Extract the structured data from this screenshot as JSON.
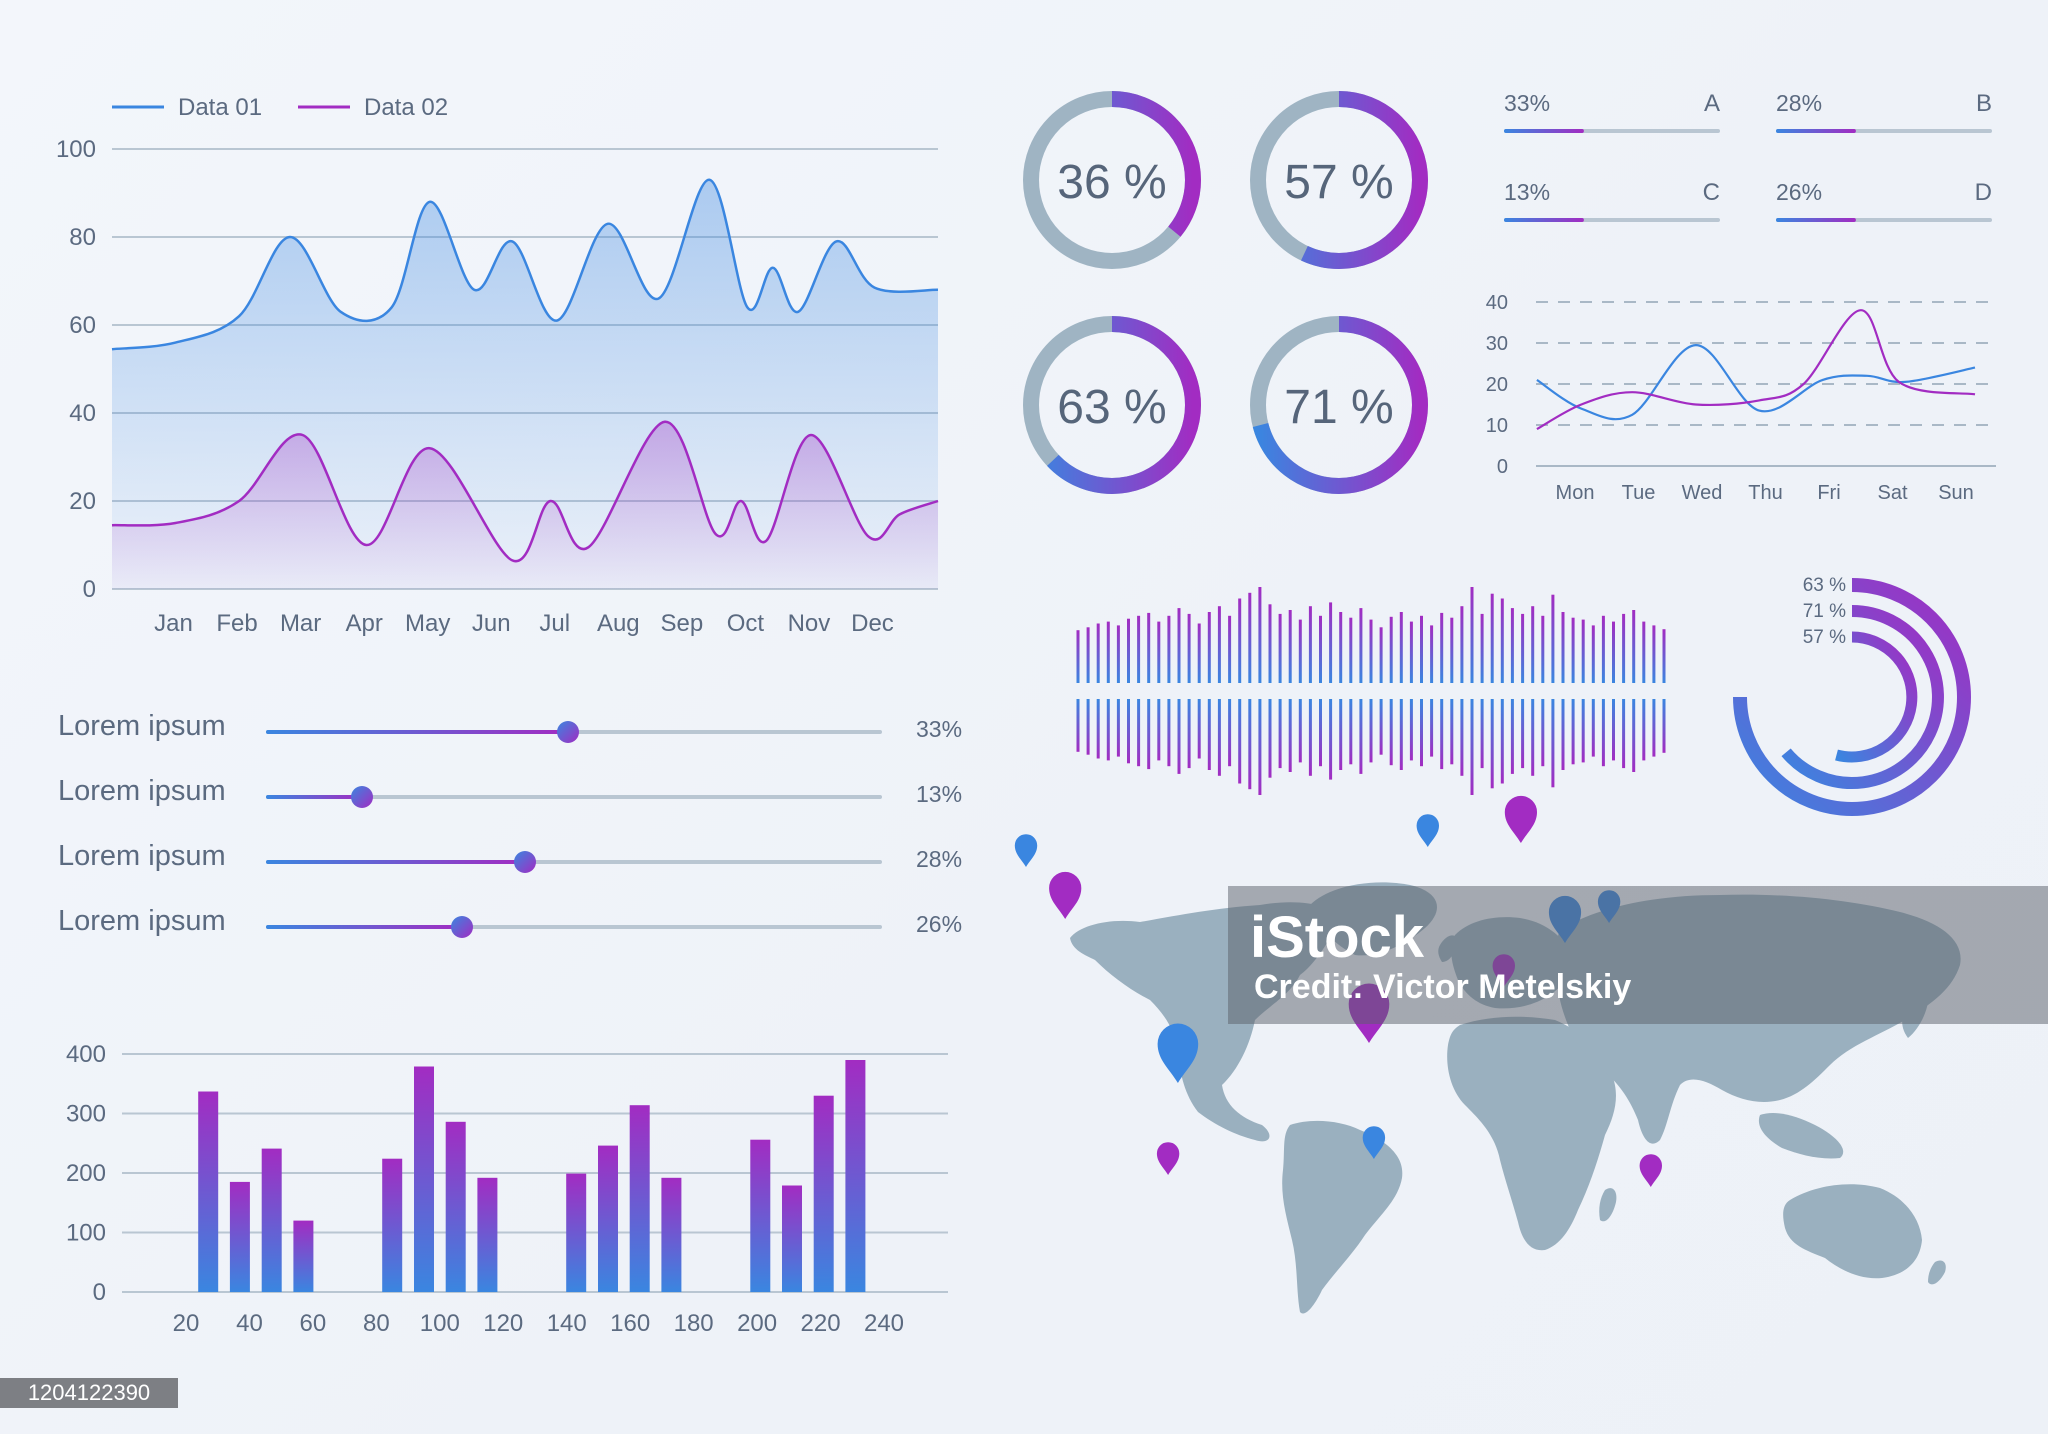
{
  "colors": {
    "blue": "#3a86e0",
    "purple": "#a22cc2",
    "gray_ring": "#9fb4c3",
    "grid": "#b9c6d2",
    "map": "#9ab0bf"
  },
  "chart_data": [
    {
      "type": "area",
      "legend": [
        "Data 01",
        "Data 02"
      ],
      "categories": [
        "Jan",
        "Feb",
        "Mar",
        "Apr",
        "May",
        "Jun",
        "Jul",
        "Aug",
        "Sep",
        "Oct",
        "Nov",
        "Dec"
      ],
      "yticks": [
        0,
        20,
        40,
        60,
        80,
        100
      ],
      "ylim": [
        0,
        100
      ],
      "x_range": [
        0,
        13
      ],
      "series": [
        {
          "name": "Data 01",
          "color": "#3a86e0",
          "points": [
            [
              0,
              54.5
            ],
            [
              1,
              56
            ],
            [
              2,
              62
            ],
            [
              2.8,
              80
            ],
            [
              3.6,
              63
            ],
            [
              4.4,
              64
            ],
            [
              5,
              88
            ],
            [
              5.7,
              68
            ],
            [
              6.3,
              79
            ],
            [
              7,
              61
            ],
            [
              7.8,
              83
            ],
            [
              8.6,
              66
            ],
            [
              9.4,
              93
            ],
            [
              10,
              64
            ],
            [
              10.4,
              73
            ],
            [
              10.8,
              63
            ],
            [
              11.4,
              79
            ],
            [
              12,
              68.5
            ],
            [
              13,
              68
            ]
          ]
        },
        {
          "name": "Data 02",
          "color": "#a22cc2",
          "points": [
            [
              0,
              14.5
            ],
            [
              1,
              15
            ],
            [
              2,
              20
            ],
            [
              3,
              35
            ],
            [
              4,
              10
            ],
            [
              5,
              32
            ],
            [
              6.3,
              6.5
            ],
            [
              6.9,
              20
            ],
            [
              7.5,
              9.5
            ],
            [
              8.7,
              38
            ],
            [
              9.5,
              12.5
            ],
            [
              9.9,
              20
            ],
            [
              10.3,
              11
            ],
            [
              11,
              35
            ],
            [
              11.9,
              12
            ],
            [
              12.4,
              17
            ],
            [
              13,
              20
            ]
          ]
        }
      ]
    },
    {
      "type": "bar",
      "xticks": [
        20,
        40,
        60,
        80,
        100,
        120,
        140,
        160,
        180,
        200,
        220,
        240
      ],
      "yticks": [
        0,
        100,
        200,
        300,
        400
      ],
      "xlim": [
        20,
        240
      ],
      "ylim": [
        0,
        400
      ],
      "groups": [
        {
          "x": [
            27,
            37,
            47,
            57
          ],
          "values": [
            337,
            185,
            241,
            120
          ]
        },
        {
          "x": [
            85,
            95,
            105,
            115
          ],
          "values": [
            224,
            379,
            286,
            192
          ]
        },
        {
          "x": [
            143,
            153,
            163,
            173
          ],
          "values": [
            199,
            246,
            314,
            192
          ]
        },
        {
          "x": [
            201,
            211,
            221,
            231
          ],
          "values": [
            256,
            179,
            330,
            390
          ]
        }
      ]
    },
    {
      "type": "line",
      "categories": [
        "Mon",
        "Tue",
        "Wed",
        "Thu",
        "Fri",
        "Sat",
        "Sun"
      ],
      "yticks": [
        0,
        10,
        20,
        30,
        40
      ],
      "ylim": [
        0,
        40
      ],
      "series": [
        {
          "color": "#3a86e0",
          "points": [
            [
              -0.6,
              21
            ],
            [
              0.1,
              14
            ],
            [
              0.9,
              12.5
            ],
            [
              1.9,
              29.5
            ],
            [
              2.9,
              13.5
            ],
            [
              3.9,
              21
            ],
            [
              4.6,
              22
            ],
            [
              5.2,
              20.5
            ],
            [
              6.3,
              24
            ]
          ]
        },
        {
          "color": "#a22cc2",
          "points": [
            [
              -0.6,
              9
            ],
            [
              0.1,
              15
            ],
            [
              0.9,
              18
            ],
            [
              1.9,
              15
            ],
            [
              2.9,
              16
            ],
            [
              3.6,
              20
            ],
            [
              4.5,
              38
            ],
            [
              5.1,
              20.5
            ],
            [
              6.3,
              17.5
            ]
          ]
        }
      ]
    },
    {
      "type": "donut",
      "values": [
        36,
        57,
        63,
        71
      ],
      "labels": [
        "36 %",
        "57 %",
        "63 %",
        "71 %"
      ]
    },
    {
      "type": "progress",
      "items": [
        {
          "name": "A",
          "value": 33,
          "label": "33%"
        },
        {
          "name": "B",
          "value": 28,
          "label": "28%"
        },
        {
          "name": "C",
          "value": 13,
          "label": "13%"
        },
        {
          "name": "D",
          "value": 26,
          "label": "26%"
        }
      ]
    },
    {
      "type": "radial",
      "rings": [
        {
          "label": "63 %",
          "value": 63
        },
        {
          "label": "71 %",
          "value": 71
        },
        {
          "label": "57 %",
          "value": 57
        }
      ]
    },
    {
      "type": "waveform",
      "values": [
        0.55,
        0.58,
        0.62,
        0.64,
        0.6,
        0.67,
        0.7,
        0.73,
        0.64,
        0.7,
        0.78,
        0.72,
        0.62,
        0.74,
        0.8,
        0.7,
        0.88,
        0.94,
        1.0,
        0.82,
        0.72,
        0.76,
        0.66,
        0.8,
        0.7,
        0.84,
        0.74,
        0.68,
        0.78,
        0.66,
        0.58,
        0.69,
        0.74,
        0.64,
        0.7,
        0.6,
        0.73,
        0.68,
        0.8,
        1.0,
        0.72,
        0.93,
        0.88,
        0.78,
        0.72,
        0.8,
        0.7,
        0.92,
        0.74,
        0.68,
        0.66,
        0.6,
        0.7,
        0.64,
        0.72,
        0.76,
        0.64,
        0.6,
        0.56
      ]
    }
  ],
  "sliders": [
    {
      "label": "Lorem ipsum",
      "value": 0.49,
      "pct": "33%"
    },
    {
      "label": "Lorem ipsum",
      "value": 0.156,
      "pct": "13%"
    },
    {
      "label": "Lorem ipsum",
      "value": 0.42,
      "pct": "28%"
    },
    {
      "label": "Lorem ipsum",
      "value": 0.318,
      "pct": "26%"
    }
  ],
  "map": {
    "pins": [
      {
        "lon": -120,
        "lat": 52,
        "color": "blue",
        "size": "s"
      },
      {
        "lon": -104,
        "lat": 39,
        "color": "purple",
        "size": "m"
      },
      {
        "lon": -58,
        "lat": -2,
        "color": "blue",
        "size": "l"
      },
      {
        "lon": -62,
        "lat": -25,
        "color": "purple",
        "size": "s"
      },
      {
        "lon": 20,
        "lat": 8,
        "color": "purple",
        "size": "l"
      },
      {
        "lon": 22,
        "lat": -21,
        "color": "blue",
        "size": "s"
      },
      {
        "lon": 75,
        "lat": 22,
        "color": "purple",
        "size": "s"
      },
      {
        "lon": 100,
        "lat": 33,
        "color": "blue",
        "size": "m"
      },
      {
        "lon": 118,
        "lat": 38,
        "color": "blue",
        "size": "s"
      },
      {
        "lon": 82,
        "lat": 58,
        "color": "purple",
        "size": "m"
      },
      {
        "lon": 135,
        "lat": -28,
        "color": "purple",
        "size": "s"
      },
      {
        "lon": 44,
        "lat": 57,
        "color": "blue",
        "size": "s"
      }
    ]
  },
  "watermark": {
    "brand": "iStock",
    "credit": "Credit: Victor Metelskiy"
  },
  "stock_id": "1204122390"
}
